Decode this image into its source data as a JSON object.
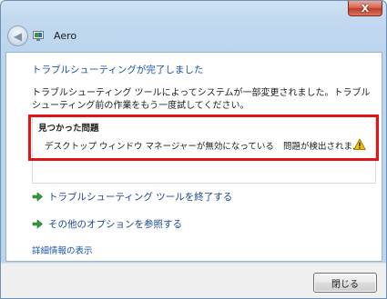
{
  "window": {
    "title": "Aero",
    "close_glyph": "X"
  },
  "nav": {
    "back_glyph": "◀"
  },
  "content": {
    "heading": "トラブルシューティングが完了しました",
    "description": "トラブルシューティング ツールによってシステムが一部変更されました。トラブルシューティング前の作業をもう一度試してください。",
    "problems": {
      "title": "見つかった問題",
      "items": [
        {
          "name": "デスクトップ ウィンドウ マネージャーが無効になっている",
          "status": "問題が検出されま...",
          "icon": "warning-icon"
        }
      ]
    },
    "actions": [
      {
        "label": "トラブルシューティング ツールを終了する",
        "icon": "green-arrow-icon"
      },
      {
        "label": "その他のオプションを参照する",
        "icon": "green-arrow-icon"
      }
    ],
    "details_link": "詳細情報の表示"
  },
  "footer": {
    "close_label": "閉じる"
  },
  "colors": {
    "link": "#1a55a8",
    "highlight": "#e51414",
    "arrow": "#2e9b3e",
    "warning": "#f2c200"
  }
}
